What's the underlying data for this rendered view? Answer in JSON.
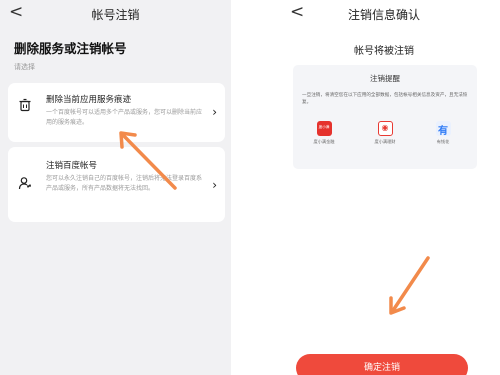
{
  "left": {
    "nav": {
      "back": "<",
      "title": "帐号注销"
    },
    "heading": "删除服务或注销帐号",
    "subheading": "请选择",
    "options": [
      {
        "title": "删除当前应用服务痕迹",
        "description": "一个百度帐号可以适用多个产品或服务，您可以删除当前应用的服务痕迹。",
        "icon": "trash-icon"
      },
      {
        "title": "注销百度帐号",
        "description": "您可以永久注销自己的百度帐号，注销后将无法登录百度系产品或服务，所有产品数据将无法找回。",
        "icon": "user-remove-icon"
      }
    ]
  },
  "right": {
    "nav": {
      "back": "<",
      "title": "注销信息确认"
    },
    "heading": "帐号将被注销",
    "reminder": {
      "title": "注销提醒",
      "text": "一旦注销，将清空您在以下应用的全部数据，包括帐号相关信息及资产，且无法恢复。",
      "apps": [
        {
          "label": "度小满金融",
          "icon": "duxiaoman-icon",
          "badge": "度小满",
          "color": "#e5322d"
        },
        {
          "label": "度小满理财",
          "icon": "licai-icon",
          "badge": "◉",
          "color": "#e83a33"
        },
        {
          "label": "有钱花",
          "icon": "youqianhua-icon",
          "badge": "有",
          "color": "#2f7bf6"
        }
      ]
    },
    "confirm_button": "确定注销"
  },
  "colors": {
    "accent": "#ef4a3c",
    "annotation_arrow": "#f28a4b",
    "panel_bg": "#f1f1f3"
  }
}
